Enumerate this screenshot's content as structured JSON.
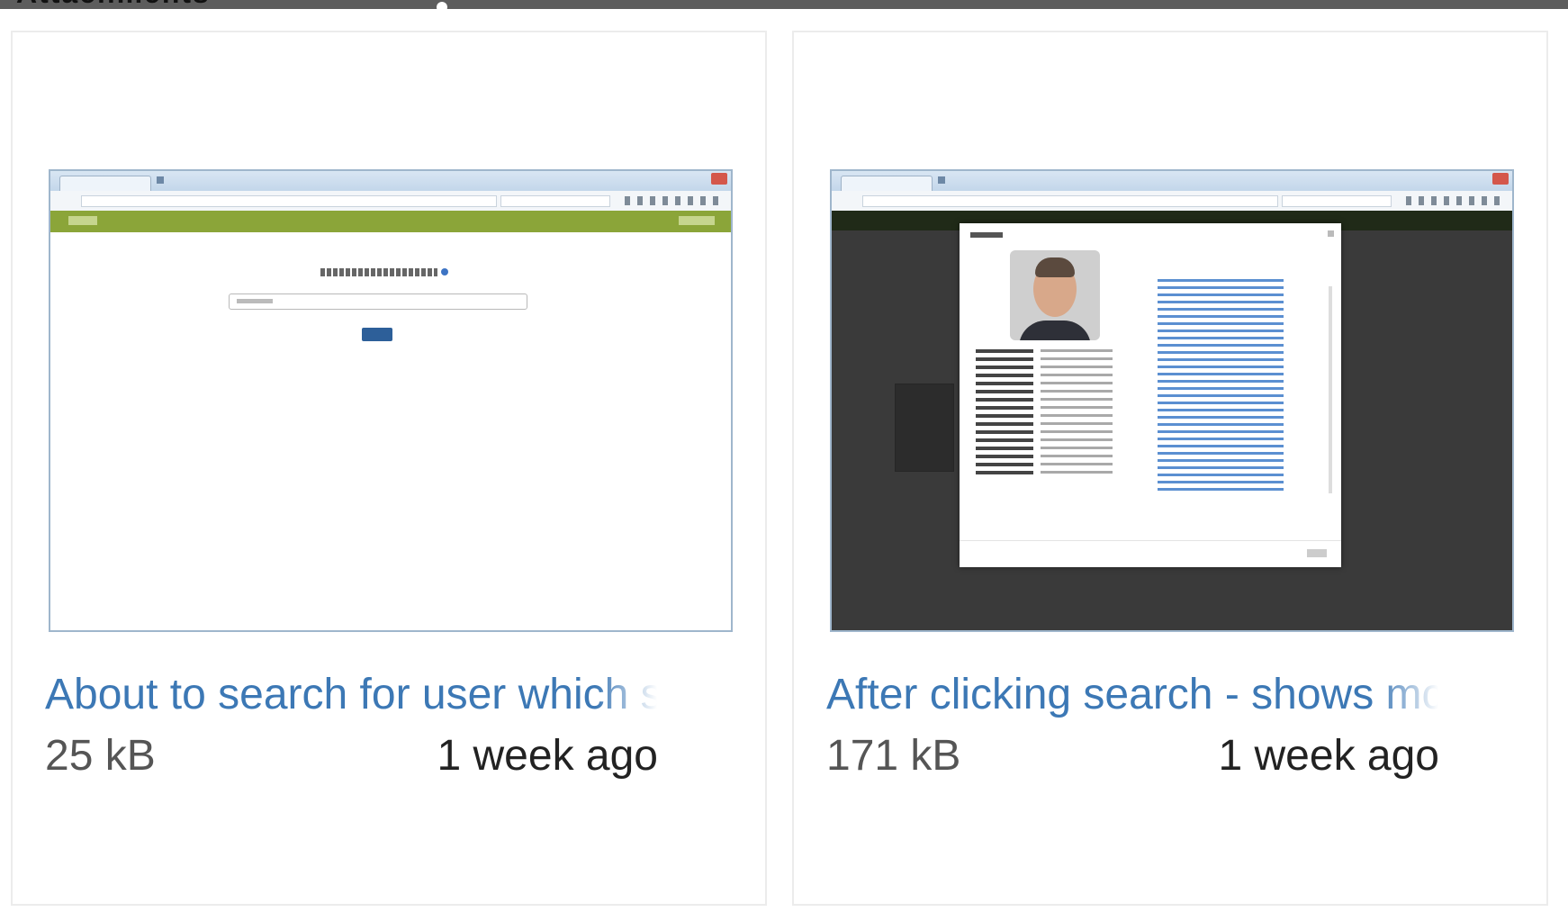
{
  "page": {
    "heading": "Attachments"
  },
  "attachments": [
    {
      "caption": "About to search for user which s",
      "size": "25 kB",
      "time": "1 week ago",
      "thumbnail": "screenshot-search-page"
    },
    {
      "caption": "After clicking search - shows mc",
      "size": "171 kB",
      "time": "1 week ago",
      "thumbnail": "screenshot-user-details-modal"
    }
  ],
  "colors": {
    "link": "#3c78b5",
    "meta_text": "#555555",
    "card_border": "#ececec",
    "thumb_border": "#9fb6cc",
    "app_header_green": "#8ba539"
  }
}
